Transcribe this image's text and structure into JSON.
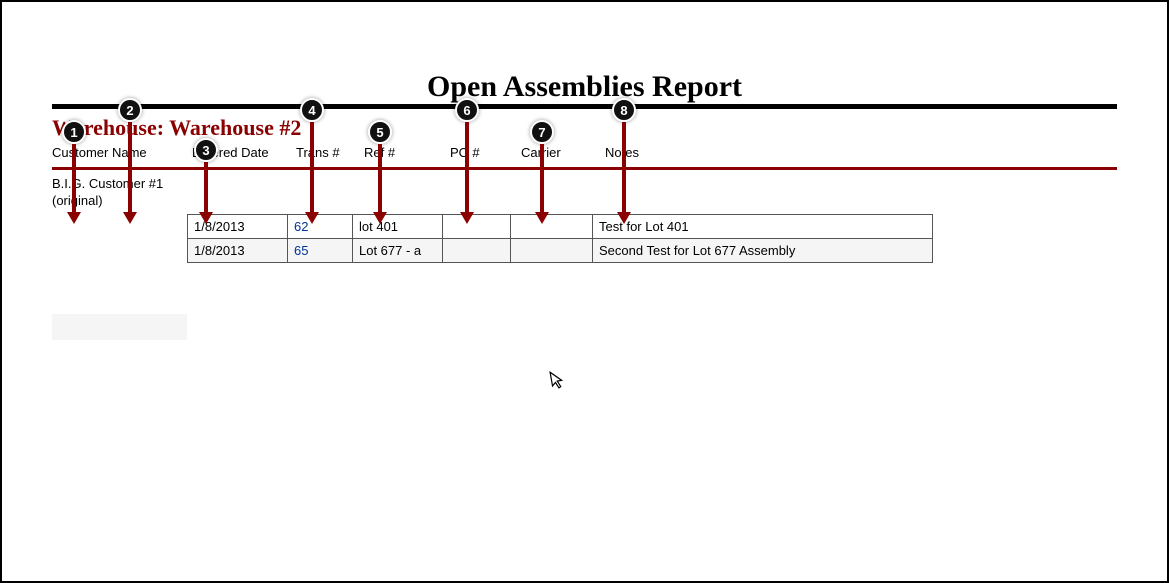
{
  "title": "Open Assemblies Report",
  "warehouse_label": "Warehouse: Warehouse #2",
  "columns": {
    "customer": "Customer Name",
    "entered": "Entered Date",
    "trans": "Trans #",
    "ref": "Ref #",
    "po": "PO #",
    "carrier": "Carrier",
    "notes": "Notes"
  },
  "customer": {
    "name": "B.I.G. Customer #1",
    "sub": "(original)"
  },
  "rows": [
    {
      "date": "1/8/2013",
      "trans": "62",
      "ref": "lot 401",
      "po": "",
      "carrier": "",
      "notes": "Test for Lot 401"
    },
    {
      "date": "1/8/2013",
      "trans": "65",
      "ref": "Lot 677 - a",
      "po": "",
      "carrier": "",
      "notes": "Second Test for Lot 677 Assembly"
    }
  ],
  "markers": {
    "m1": "1",
    "m2": "2",
    "m3": "3",
    "m4": "4",
    "m5": "5",
    "m6": "6",
    "m7": "7",
    "m8": "8"
  }
}
